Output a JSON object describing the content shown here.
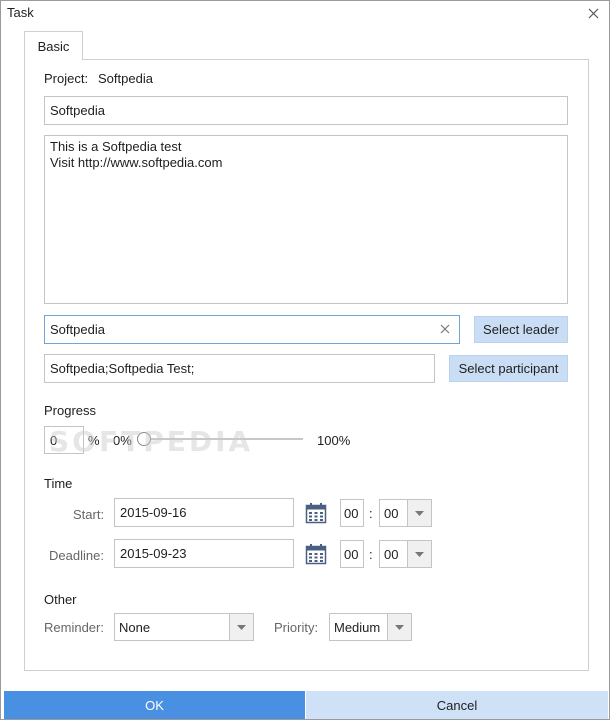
{
  "window": {
    "title": "Task"
  },
  "tabs": [
    {
      "label": "Basic",
      "active": true
    }
  ],
  "project": {
    "label": "Project:",
    "value": "Softpedia"
  },
  "task_name": {
    "value": "Softpedia"
  },
  "description": {
    "lines": [
      "This is a Softpedia test",
      "Visit http://www.softpedia.com"
    ]
  },
  "leader": {
    "value": "Softpedia",
    "button_label": "Select leader"
  },
  "participant": {
    "value": "Softpedia;Softpedia Test;",
    "button_label": "Select participant"
  },
  "progress": {
    "heading": "Progress",
    "value": "0",
    "unit": "%",
    "min_label": "0%",
    "max_label": "100%",
    "fraction": 0
  },
  "time": {
    "heading": "Time",
    "start": {
      "label": "Start:",
      "date": "2015-09-16",
      "hour": "00",
      "minute": "00"
    },
    "deadline": {
      "label": "Deadline:",
      "date": "2015-09-23",
      "hour": "00",
      "minute": "00"
    },
    "separator": ":"
  },
  "other": {
    "heading": "Other",
    "reminder": {
      "label": "Reminder:",
      "value": "None"
    },
    "priority": {
      "label": "Priority:",
      "value": "Medium"
    }
  },
  "footer": {
    "ok_label": "OK",
    "cancel_label": "Cancel"
  },
  "watermark": "SOFTPEDIA",
  "colors": {
    "accent": "#4a90e2",
    "button_light": "#c9def5",
    "focus_border": "#6ea6d8"
  }
}
